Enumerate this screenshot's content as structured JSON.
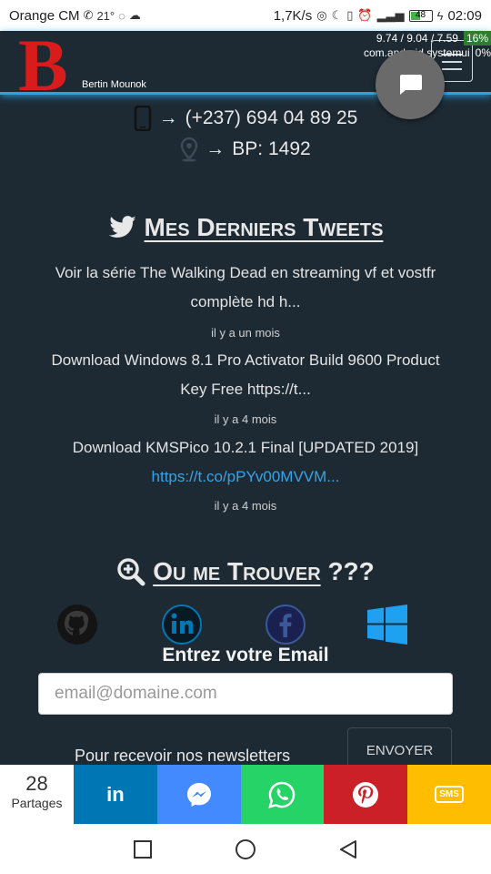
{
  "status_bar": {
    "carrier": "Orange CM",
    "temp": "21°",
    "speed": "1,7K/s",
    "battery": "48",
    "time": "02:09"
  },
  "overlay": {
    "line1": "9.74 / 9.04 / 7.59",
    "line1_pct": "16%",
    "line2": "com.android.systemui",
    "line2_pct": "0%"
  },
  "header": {
    "logo_letter": "B",
    "site_name": "Bertin Mounok",
    "brand_color": "#d81b1b",
    "accent_color": "#29a3e8"
  },
  "contact": {
    "phone_arrow": "→",
    "phone": "(+237) 694 04 89 25",
    "address_arrow": "→",
    "address": "BP: 1492"
  },
  "tweets_section": {
    "title": "Mes Derniers Tweets",
    "tweets": [
      {
        "line1": "Voir la série The Walking Dead en streaming vf et vostfr",
        "line2": "complète hd h...",
        "time": "il y a un mois"
      },
      {
        "line1": "Download Windows 8.1 Pro Activator Build 9600 Product",
        "line2": "Key Free https://t...",
        "time": "il y a 4 mois"
      },
      {
        "line1": "Download KMSPico 10.2.1 Final [UPDATED 2019]",
        "line2": "https://t.co/pPYv00MVVM...",
        "time": "il y a 4 mois"
      }
    ]
  },
  "find_section": {
    "title": "Ou me Trouver",
    "suffix": " ???",
    "icons": [
      "github-icon",
      "linkedin-icon",
      "facebook-icon",
      "windows-icon"
    ]
  },
  "newsletter": {
    "label": "Entrez votre Email",
    "placeholder": "email@domaine.com",
    "text": "Pour recevoir nos newsletters",
    "button": "ENVOYER"
  },
  "share_bar": {
    "count": "28",
    "count_label": "Partages",
    "buttons": [
      {
        "name": "linkedin",
        "color": "#0077b5",
        "label": "in"
      },
      {
        "name": "messenger",
        "color": "#448aff"
      },
      {
        "name": "whatsapp",
        "color": "#25d366"
      },
      {
        "name": "pinterest",
        "color": "#cb2027"
      },
      {
        "name": "sms",
        "color": "#ffbd00",
        "label": "SMS"
      }
    ]
  }
}
